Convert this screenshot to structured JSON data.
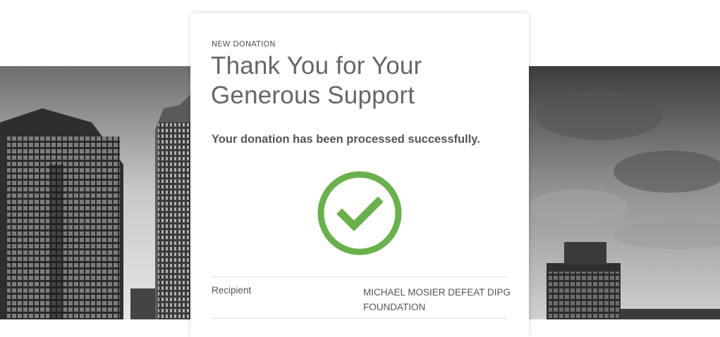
{
  "card": {
    "eyebrow": "NEW DONATION",
    "title_line1": "Thank You for Your",
    "title_line2": "Generous Support",
    "subtitle": "Your donation has been processed successfully.",
    "status_icon": "check-circle-icon",
    "details": [
      {
        "label": "Recipient",
        "value": "MICHAEL MOSIER DEFEAT DIPG FOUNDATION"
      }
    ]
  },
  "colors": {
    "success_green": "#6ab04c",
    "text": "#555555",
    "title": "#666666"
  }
}
